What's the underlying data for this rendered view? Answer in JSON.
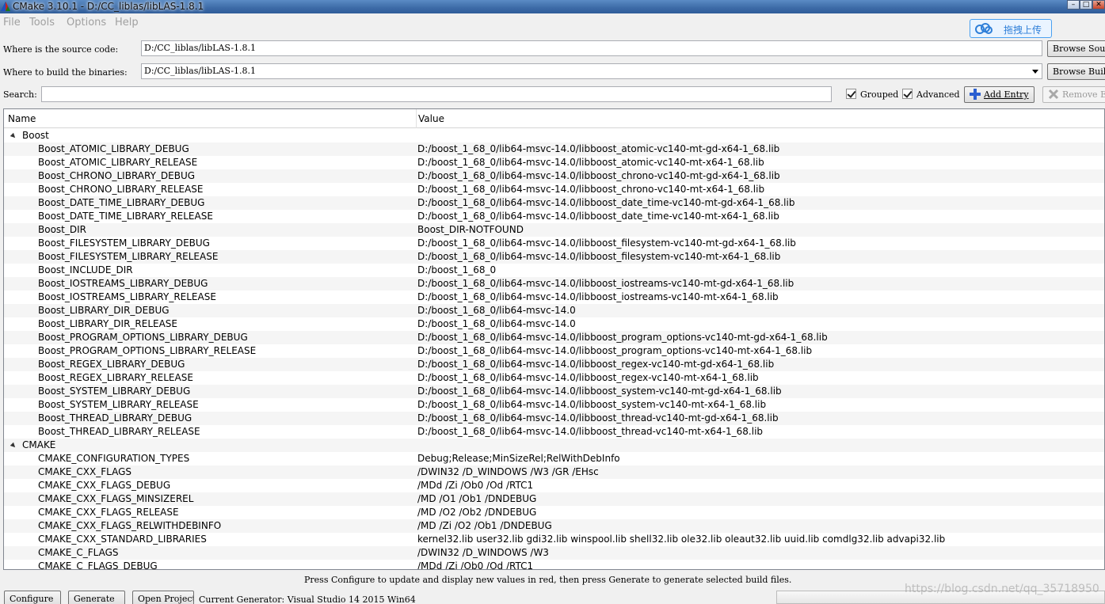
{
  "window": {
    "title": "CMake 3.10.1 - D:/CC_liblas/libLAS-1.8.1"
  },
  "menu": [
    "File",
    "Tools",
    "Options",
    "Help"
  ],
  "overlay": {
    "upload_label": "拖拽上传"
  },
  "source": {
    "label": "Where is the source code:",
    "value": "D:/CC_liblas/libLAS-1.8.1",
    "browse_label": "Browse Source..."
  },
  "build": {
    "label": "Where to build the binaries:",
    "value": "D:/CC_liblas/libLAS-1.8.1",
    "browse_label": "Browse Build..."
  },
  "search": {
    "label": "Search:",
    "value": ""
  },
  "options": {
    "grouped_label": "Grouped",
    "grouped_checked": true,
    "advanced_label": "Advanced",
    "advanced_checked": true
  },
  "toolbar": {
    "add_entry_label": "Add Entry",
    "remove_entry_label": "Remove Entry"
  },
  "table": {
    "columns": [
      "Name",
      "Value"
    ],
    "groups": [
      {
        "name": "Boost",
        "rows": [
          [
            "Boost_ATOMIC_LIBRARY_DEBUG",
            "D:/boost_1_68_0/lib64-msvc-14.0/libboost_atomic-vc140-mt-gd-x64-1_68.lib"
          ],
          [
            "Boost_ATOMIC_LIBRARY_RELEASE",
            "D:/boost_1_68_0/lib64-msvc-14.0/libboost_atomic-vc140-mt-x64-1_68.lib"
          ],
          [
            "Boost_CHRONO_LIBRARY_DEBUG",
            "D:/boost_1_68_0/lib64-msvc-14.0/libboost_chrono-vc140-mt-gd-x64-1_68.lib"
          ],
          [
            "Boost_CHRONO_LIBRARY_RELEASE",
            "D:/boost_1_68_0/lib64-msvc-14.0/libboost_chrono-vc140-mt-x64-1_68.lib"
          ],
          [
            "Boost_DATE_TIME_LIBRARY_DEBUG",
            "D:/boost_1_68_0/lib64-msvc-14.0/libboost_date_time-vc140-mt-gd-x64-1_68.lib"
          ],
          [
            "Boost_DATE_TIME_LIBRARY_RELEASE",
            "D:/boost_1_68_0/lib64-msvc-14.0/libboost_date_time-vc140-mt-x64-1_68.lib"
          ],
          [
            "Boost_DIR",
            "Boost_DIR-NOTFOUND"
          ],
          [
            "Boost_FILESYSTEM_LIBRARY_DEBUG",
            "D:/boost_1_68_0/lib64-msvc-14.0/libboost_filesystem-vc140-mt-gd-x64-1_68.lib"
          ],
          [
            "Boost_FILESYSTEM_LIBRARY_RELEASE",
            "D:/boost_1_68_0/lib64-msvc-14.0/libboost_filesystem-vc140-mt-x64-1_68.lib"
          ],
          [
            "Boost_INCLUDE_DIR",
            "D:/boost_1_68_0"
          ],
          [
            "Boost_IOSTREAMS_LIBRARY_DEBUG",
            "D:/boost_1_68_0/lib64-msvc-14.0/libboost_iostreams-vc140-mt-gd-x64-1_68.lib"
          ],
          [
            "Boost_IOSTREAMS_LIBRARY_RELEASE",
            "D:/boost_1_68_0/lib64-msvc-14.0/libboost_iostreams-vc140-mt-x64-1_68.lib"
          ],
          [
            "Boost_LIBRARY_DIR_DEBUG",
            "D:/boost_1_68_0/lib64-msvc-14.0"
          ],
          [
            "Boost_LIBRARY_DIR_RELEASE",
            "D:/boost_1_68_0/lib64-msvc-14.0"
          ],
          [
            "Boost_PROGRAM_OPTIONS_LIBRARY_DEBUG",
            "D:/boost_1_68_0/lib64-msvc-14.0/libboost_program_options-vc140-mt-gd-x64-1_68.lib"
          ],
          [
            "Boost_PROGRAM_OPTIONS_LIBRARY_RELEASE",
            "D:/boost_1_68_0/lib64-msvc-14.0/libboost_program_options-vc140-mt-x64-1_68.lib"
          ],
          [
            "Boost_REGEX_LIBRARY_DEBUG",
            "D:/boost_1_68_0/lib64-msvc-14.0/libboost_regex-vc140-mt-gd-x64-1_68.lib"
          ],
          [
            "Boost_REGEX_LIBRARY_RELEASE",
            "D:/boost_1_68_0/lib64-msvc-14.0/libboost_regex-vc140-mt-x64-1_68.lib"
          ],
          [
            "Boost_SYSTEM_LIBRARY_DEBUG",
            "D:/boost_1_68_0/lib64-msvc-14.0/libboost_system-vc140-mt-gd-x64-1_68.lib"
          ],
          [
            "Boost_SYSTEM_LIBRARY_RELEASE",
            "D:/boost_1_68_0/lib64-msvc-14.0/libboost_system-vc140-mt-x64-1_68.lib"
          ],
          [
            "Boost_THREAD_LIBRARY_DEBUG",
            "D:/boost_1_68_0/lib64-msvc-14.0/libboost_thread-vc140-mt-gd-x64-1_68.lib"
          ],
          [
            "Boost_THREAD_LIBRARY_RELEASE",
            "D:/boost_1_68_0/lib64-msvc-14.0/libboost_thread-vc140-mt-x64-1_68.lib"
          ]
        ]
      },
      {
        "name": "CMAKE",
        "rows": [
          [
            "CMAKE_CONFIGURATION_TYPES",
            "Debug;Release;MinSizeRel;RelWithDebInfo"
          ],
          [
            "CMAKE_CXX_FLAGS",
            "/DWIN32 /D_WINDOWS /W3 /GR /EHsc"
          ],
          [
            "CMAKE_CXX_FLAGS_DEBUG",
            "/MDd /Zi /Ob0 /Od /RTC1"
          ],
          [
            "CMAKE_CXX_FLAGS_MINSIZEREL",
            "/MD /O1 /Ob1 /DNDEBUG"
          ],
          [
            "CMAKE_CXX_FLAGS_RELEASE",
            "/MD /O2 /Ob2 /DNDEBUG"
          ],
          [
            "CMAKE_CXX_FLAGS_RELWITHDEBINFO",
            "/MD /Zi /O2 /Ob1 /DNDEBUG"
          ],
          [
            "CMAKE_CXX_STANDARD_LIBRARIES",
            "kernel32.lib user32.lib gdi32.lib winspool.lib shell32.lib ole32.lib oleaut32.lib uuid.lib comdlg32.lib advapi32.lib"
          ],
          [
            "CMAKE_C_FLAGS",
            "/DWIN32 /D_WINDOWS /W3"
          ],
          [
            "CMAKE_C_FLAGS_DEBUG",
            "/MDd /Zi /Ob0 /Od /RTC1"
          ]
        ]
      }
    ]
  },
  "status_text": "Press Configure to update and display new values in red, then press Generate to generate selected build files.",
  "bottom": {
    "configure_label": "Configure",
    "generate_label": "Generate",
    "open_project_label": "Open Project",
    "generator_text": "Current Generator: Visual Studio 14 2015 Win64"
  },
  "watermark": "https://blog.csdn.net/qq_35718950",
  "colors": {
    "title_bar": "#3c6aa6",
    "accent": "#2f7fd8"
  }
}
